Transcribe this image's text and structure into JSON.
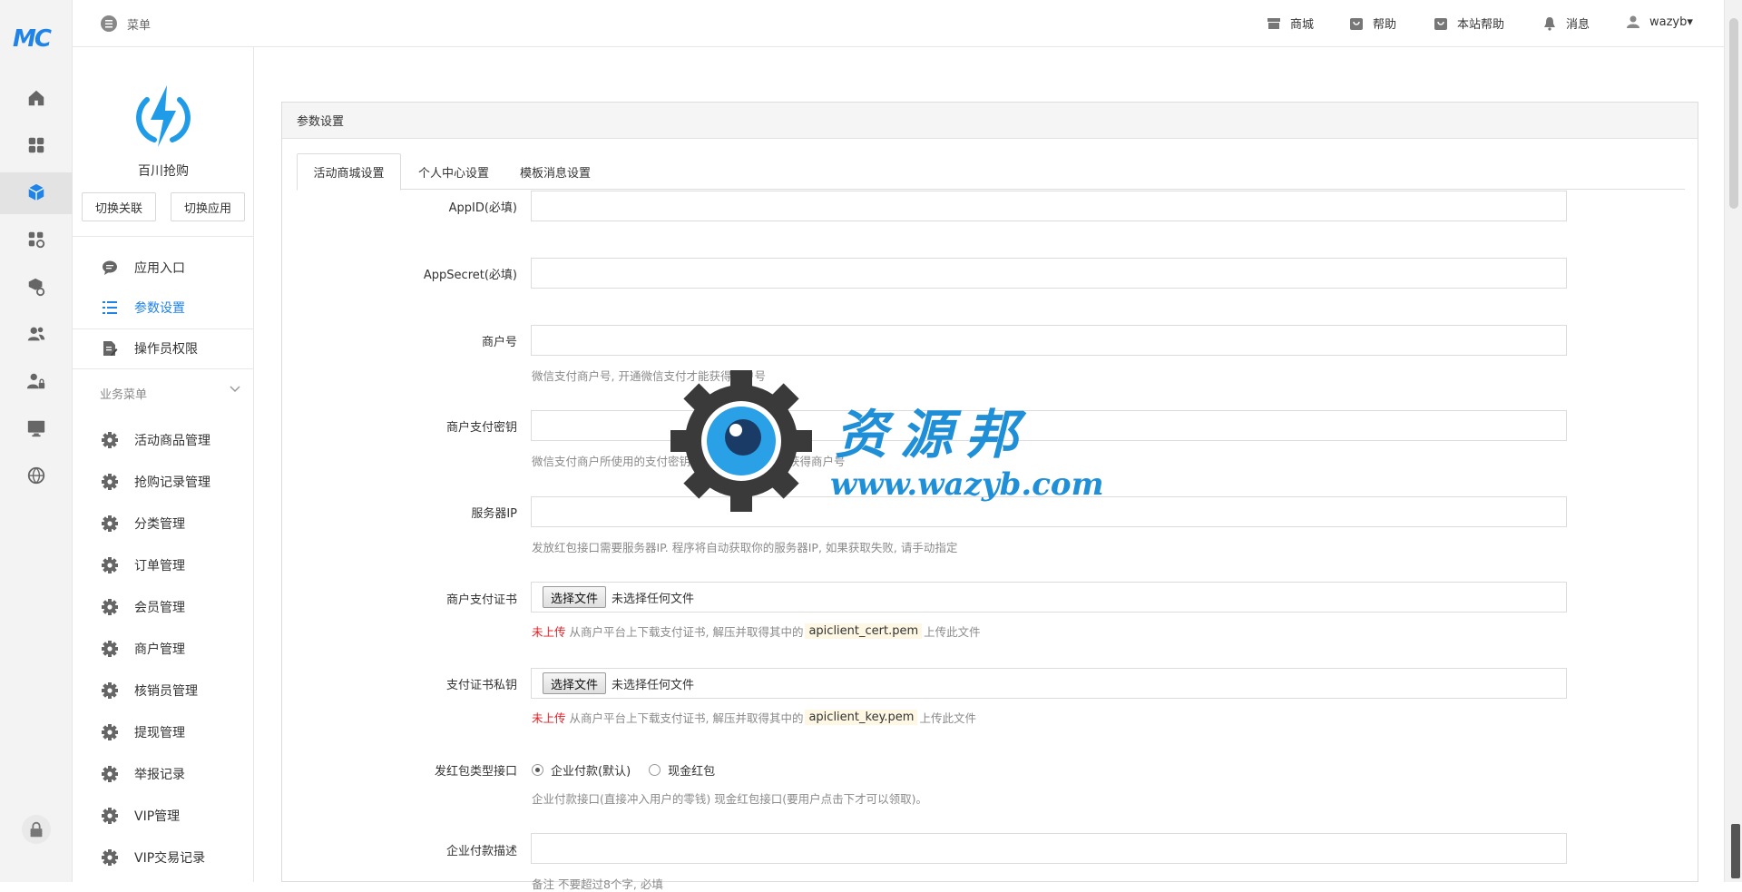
{
  "rail": {
    "logo": "MC",
    "icons": [
      "home-icon",
      "grid-icon",
      "cube-icon",
      "apps-settings-icon",
      "box-settings-icon",
      "users-icon",
      "user-lock-icon",
      "monitor-icon",
      "globe-icon",
      "lock-icon"
    ],
    "active": "cube-icon"
  },
  "topbar": {
    "menu_label": "菜单",
    "links": [
      {
        "label": "商城",
        "icon": "store-icon"
      },
      {
        "label": "帮助",
        "icon": "help-bag-icon"
      },
      {
        "label": "本站帮助",
        "icon": "site-help-icon"
      },
      {
        "label": "消息",
        "icon": "bell-icon"
      },
      {
        "label": "wazyb▾",
        "icon": "user-icon"
      }
    ]
  },
  "app": {
    "name": "百川抢购",
    "switch_assoc": "切换关联",
    "switch_app": "切换应用"
  },
  "nav": {
    "top_items": [
      {
        "label": "应用入口",
        "icon": "chat-icon"
      },
      {
        "label": "参数设置",
        "icon": "list-icon",
        "active": true
      },
      {
        "label": "操作员权限",
        "icon": "doc-edit-icon"
      }
    ],
    "biz_title": "业务菜单",
    "biz_items": [
      {
        "label": "活动商品管理"
      },
      {
        "label": "抢购记录管理"
      },
      {
        "label": "分类管理"
      },
      {
        "label": "订单管理"
      },
      {
        "label": "会员管理"
      },
      {
        "label": "商户管理"
      },
      {
        "label": "核销员管理"
      },
      {
        "label": "提现管理"
      },
      {
        "label": "举报记录"
      },
      {
        "label": "VIP管理"
      },
      {
        "label": "VIP交易记录"
      }
    ]
  },
  "panel": {
    "title": "参数设置",
    "tabs": [
      "活动商城设置",
      "个人中心设置",
      "模板消息设置"
    ],
    "active_tab": 0
  },
  "form": {
    "appid_label": "AppID(必填)",
    "appid_value": "",
    "appsecret_label": "AppSecret(必填)",
    "appsecret_value": "",
    "mchid_label": "商户号",
    "mchid_value": "",
    "mchid_help": "微信支付商户号, 开通微信支付才能获得商户号",
    "mchkey_label": "商户支付密钥",
    "mchkey_value": "",
    "mchkey_help": "微信支付商户所使用的支付密钥, 开通微信支付才能获得商户号",
    "serverip_label": "服务器IP",
    "serverip_value": "",
    "serverip_help": "发放红包接口需要服务器IP. 程序将自动获取你的服务器IP, 如果获取失败, 请手动指定",
    "cert_label": "商户支付证书",
    "key_label": "支付证书私钥",
    "file_button": "选择文件",
    "file_none": "未选择任何文件",
    "not_uploaded": "未上传",
    "upload_pre": "从商户平台上下载支付证书, 解压并取得其中的",
    "cert_file": "apiclient_cert.pem",
    "key_file": "apiclient_key.pem",
    "upload_post": "上传此文件",
    "redpack_label": "发红包类型接口",
    "redpack_opt1": "企业付款(默认)",
    "redpack_opt2": "现金红包",
    "redpack_selected": "企业付款(默认)",
    "redpack_help": "企业付款接口(直接冲入用户的零钱) 现金红包接口(要用户点击下才可以领取)。",
    "paydesc_label": "企业付款描述",
    "paydesc_value": "",
    "paydesc_help": "备注 不要超过8个字, 必填"
  },
  "watermark": {
    "title": "资源邦",
    "url": "www.wazyb.com"
  },
  "colors": {
    "accent": "#1f83e8",
    "error": "#e31e24",
    "help_text": "#8a8a8a"
  }
}
